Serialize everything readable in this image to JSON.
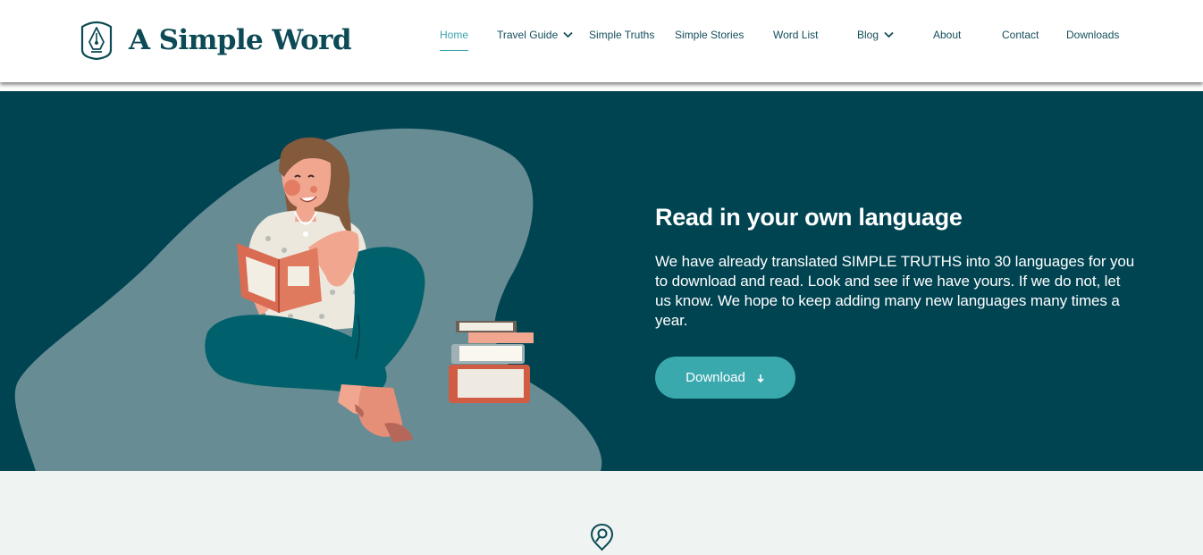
{
  "header": {
    "site_title": "A Simple Word",
    "nav": [
      {
        "label": "Home",
        "active": true
      },
      {
        "label": "Travel Guide",
        "has_dropdown": true
      },
      {
        "label": "Simple Truths"
      },
      {
        "label": "Simple Stories"
      },
      {
        "label": "Word List"
      },
      {
        "label": "Blog",
        "has_dropdown": true
      },
      {
        "label": "About"
      },
      {
        "label": "Contact"
      },
      {
        "label": "Downloads"
      }
    ]
  },
  "hero": {
    "title": "Read in your own language",
    "text": "We have already translated SIMPLE TRUTHS into 30 languages for you to download and read. Look and see if we have yours. If we do not, let us know. We hope to keep adding many new languages many times a year.",
    "button_label": "Download",
    "illustration": "woman-reading-book-illustration"
  },
  "icons": {
    "logo": "fountain-pen-nib-icon",
    "dropdown": "chevron-down-icon",
    "download": "arrow-down-icon",
    "section": "location-pin-icon"
  },
  "colors": {
    "accent": "#3aa9ae",
    "hero_background": "#004452",
    "brand_text": "#0c4a55",
    "section_background": "#eff3f2"
  }
}
